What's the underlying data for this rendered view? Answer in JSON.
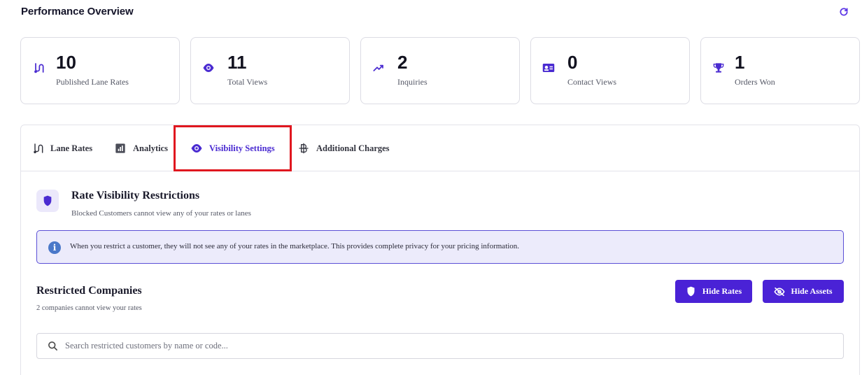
{
  "header": {
    "title": "Performance Overview",
    "refresh_icon": "refresh-icon"
  },
  "stats": [
    {
      "value": "10",
      "label": "Published Lane Rates",
      "icon": "route-icon"
    },
    {
      "value": "11",
      "label": "Total Views",
      "icon": "eye-icon"
    },
    {
      "value": "2",
      "label": "Inquiries",
      "icon": "trending-up-icon"
    },
    {
      "value": "0",
      "label": "Contact Views",
      "icon": "contact-card-icon"
    },
    {
      "value": "1",
      "label": "Orders Won",
      "icon": "trophy-icon"
    }
  ],
  "tabs": [
    {
      "label": "Lane Rates",
      "icon": "route-icon",
      "active": false
    },
    {
      "label": "Analytics",
      "icon": "analytics-icon",
      "active": false
    },
    {
      "label": "Visibility Settings",
      "icon": "eye-icon",
      "active": true
    },
    {
      "label": "Additional Charges",
      "icon": "baht-icon",
      "active": false
    }
  ],
  "visibility": {
    "title": "Rate Visibility Restrictions",
    "subtitle": "Blocked Customers cannot view any of your rates or lanes",
    "info": "When you restrict a customer, they will not see any of your rates in the marketplace. This provides complete privacy for your pricing information."
  },
  "restricted": {
    "title": "Restricted Companies",
    "subtitle": "2 companies cannot view your rates",
    "hide_rates_label": "Hide Rates",
    "hide_assets_label": "Hide Assets",
    "search_placeholder": "Search restricted customers by name or code..."
  },
  "colors": {
    "accent": "#4a22d6",
    "highlight": "#e0171f",
    "info_bg": "#ecebfb"
  }
}
